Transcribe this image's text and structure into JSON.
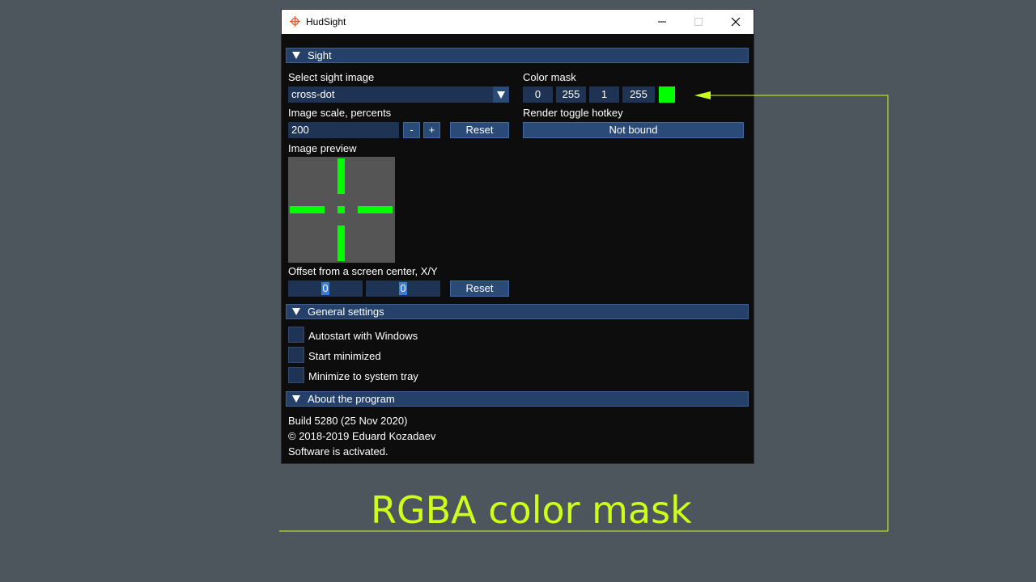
{
  "window": {
    "title": "HudSight"
  },
  "sight": {
    "header": "Sight",
    "select_label": "Select sight image",
    "select_value": "cross-dot",
    "scale_label": "Image scale, percents",
    "scale_value": "200",
    "minus_label": "-",
    "plus_label": "+",
    "scale_reset_label": "Reset",
    "preview_label": "Image preview",
    "offset_label": "Offset from a screen center, X/Y",
    "offset_x": "0",
    "offset_y": "0",
    "offset_reset_label": "Reset",
    "color_mask_label": "Color mask",
    "color_mask": {
      "r": "0",
      "g": "255",
      "b": "1",
      "a": "255"
    },
    "swatch_color": "#00ff00",
    "hotkey_label": "Render toggle hotkey",
    "hotkey_value": "Not bound"
  },
  "general": {
    "header": "General settings",
    "options": [
      {
        "label": "Autostart with Windows",
        "checked": false
      },
      {
        "label": "Start minimized",
        "checked": false
      },
      {
        "label": "Minimize to system tray",
        "checked": false
      }
    ]
  },
  "about": {
    "header": "About the program",
    "build": "Build 5280 (25 Nov 2020)",
    "copyright": "© 2018-2019 Eduard Kozadaev",
    "status": "Software is activated."
  },
  "annotation": {
    "caption": "RGBA color mask",
    "color": "#ccff1a"
  }
}
